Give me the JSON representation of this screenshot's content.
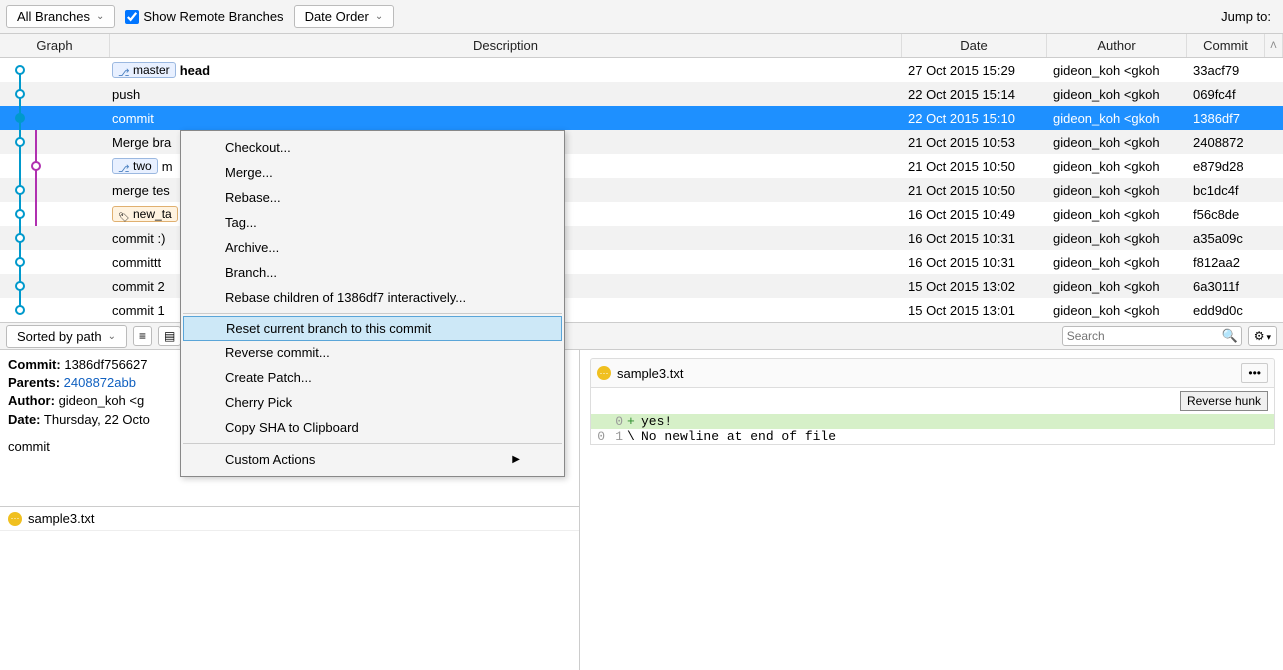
{
  "toolbar": {
    "branches_filter": "All Branches",
    "show_remote_label": "Show Remote Branches",
    "order_label": "Date Order",
    "jump_label": "Jump to:"
  },
  "columns": {
    "graph": "Graph",
    "desc": "Description",
    "date": "Date",
    "author": "Author",
    "commit": "Commit"
  },
  "commits": [
    {
      "badge": "master",
      "badge_type": "branch",
      "desc_bold": "head",
      "desc": "",
      "date": "27 Oct 2015 15:29",
      "author": "gideon_koh <gkoh",
      "hash": "33acf79",
      "sel": false
    },
    {
      "badge": "",
      "desc": "push",
      "date": "22 Oct 2015 15:14",
      "author": "gideon_koh <gkoh",
      "hash": "069fc4f",
      "sel": false
    },
    {
      "badge": "",
      "desc": "commit",
      "date": "22 Oct 2015 15:10",
      "author": "gideon_koh <gkoh",
      "hash": "1386df7",
      "sel": true
    },
    {
      "badge": "",
      "desc": "Merge bra",
      "date": "21 Oct 2015 10:53",
      "author": "gideon_koh <gkoh",
      "hash": "2408872",
      "sel": false,
      "merge": true
    },
    {
      "badge": "two",
      "badge_type": "branch",
      "desc": "m",
      "date": "21 Oct 2015 10:50",
      "author": "gideon_koh <gkoh",
      "hash": "e879d28",
      "sel": false,
      "second": true
    },
    {
      "badge": "",
      "desc": "merge tes",
      "date": "21 Oct 2015 10:50",
      "author": "gideon_koh <gkoh",
      "hash": "bc1dc4f",
      "sel": false,
      "merge": true
    },
    {
      "badge": "new_ta",
      "badge_type": "tag",
      "desc": "",
      "date": "16 Oct 2015 10:49",
      "author": "gideon_koh <gkoh",
      "hash": "f56c8de",
      "sel": false
    },
    {
      "badge": "",
      "desc": "commit :)",
      "date": "16 Oct 2015 10:31",
      "author": "gideon_koh <gkoh",
      "hash": "a35a09c",
      "sel": false
    },
    {
      "badge": "",
      "desc": "committt",
      "date": "16 Oct 2015 10:31",
      "author": "gideon_koh <gkoh",
      "hash": "f812aa2",
      "sel": false
    },
    {
      "badge": "",
      "desc": "commit 2",
      "date": "15 Oct 2015 13:02",
      "author": "gideon_koh <gkoh",
      "hash": "6a3011f",
      "sel": false
    },
    {
      "badge": "",
      "desc": "commit 1",
      "date": "15 Oct 2015 13:01",
      "author": "gideon_koh <gkoh",
      "hash": "edd9d0c",
      "sel": false
    }
  ],
  "context_menu": {
    "items": [
      {
        "label": "Checkout...",
        "type": "item"
      },
      {
        "label": "Merge...",
        "type": "item"
      },
      {
        "label": "Rebase...",
        "type": "item"
      },
      {
        "label": "Tag...",
        "type": "item"
      },
      {
        "label": "Archive...",
        "type": "item"
      },
      {
        "label": "Branch...",
        "type": "item"
      },
      {
        "label": "Rebase children of 1386df7 interactively...",
        "type": "item"
      },
      {
        "type": "sep"
      },
      {
        "label": "Reset current branch to this commit",
        "type": "item",
        "hl": true
      },
      {
        "label": "Reverse commit...",
        "type": "item"
      },
      {
        "label": "Create Patch...",
        "type": "item"
      },
      {
        "label": "Cherry Pick",
        "type": "item"
      },
      {
        "label": "Copy SHA to Clipboard",
        "type": "item"
      },
      {
        "type": "sep"
      },
      {
        "label": "Custom Actions",
        "type": "item",
        "submenu": true
      }
    ]
  },
  "sortbar": {
    "sort_label": "Sorted by path",
    "search_placeholder": "Search"
  },
  "details": {
    "commit_label": "Commit:",
    "commit_hash": "1386df756627",
    "parents_label": "Parents:",
    "parents_hash": "2408872abb",
    "author_label": "Author:",
    "author_val": "gideon_koh <g",
    "date_label": "Date:",
    "date_val": "Thursday, 22 Octo",
    "message": "commit",
    "file": "sample3.txt"
  },
  "diff": {
    "filename": "sample3.txt",
    "reverse_hunk": "Reverse hunk",
    "lines": [
      {
        "old": "",
        "new": "0",
        "mk": "+",
        "txt": "yes!",
        "cls": "add"
      },
      {
        "old": "0",
        "new": "1",
        "mk": "\\",
        "txt": " No newline at end of file",
        "cls": ""
      }
    ]
  }
}
